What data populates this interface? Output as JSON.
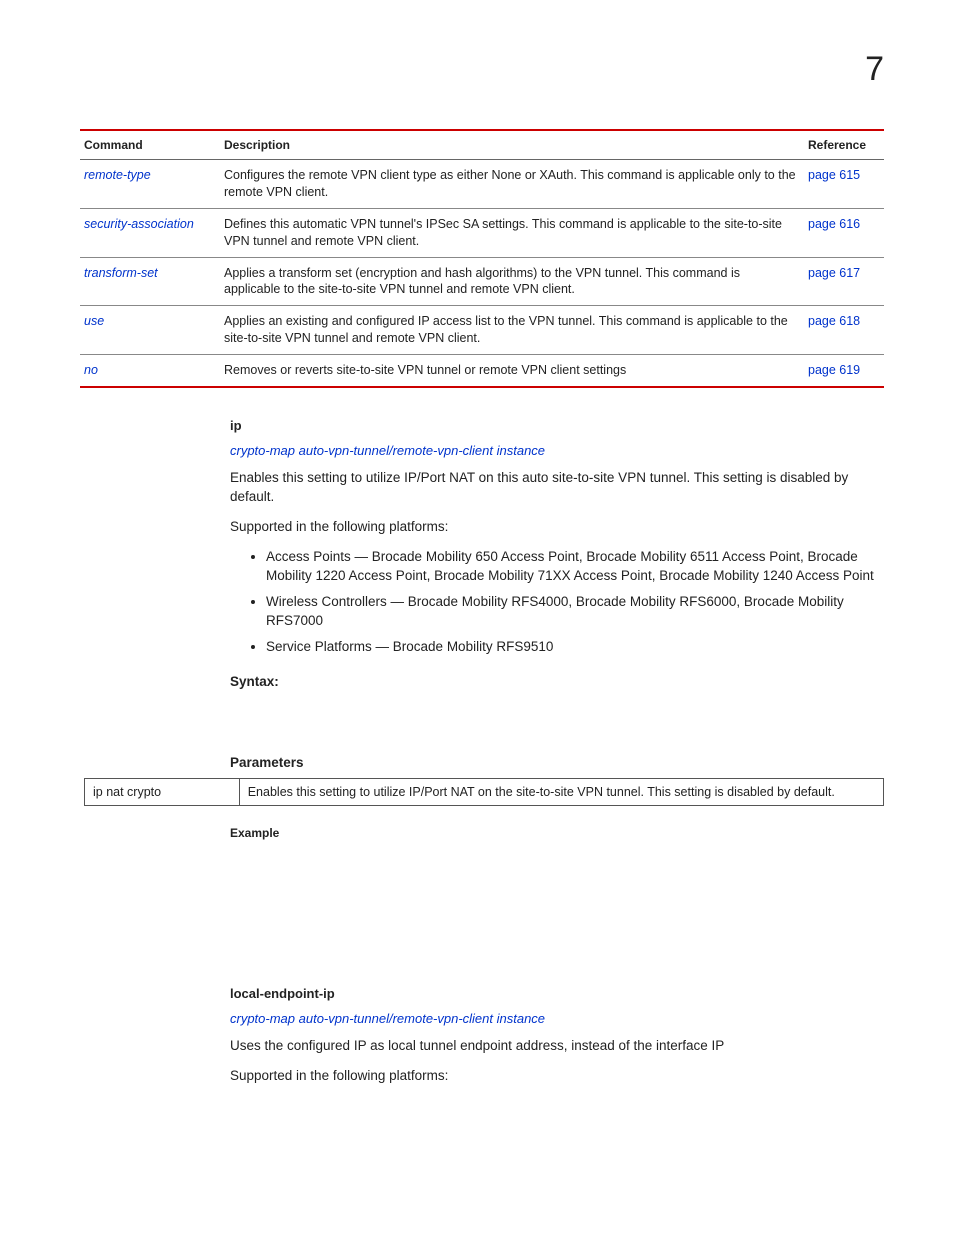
{
  "chapter_number": "7",
  "table": {
    "headers": {
      "cmd": "Command",
      "desc": "Description",
      "ref": "Reference"
    },
    "rows": [
      {
        "cmd": "remote-type",
        "desc": "Configures the remote VPN client type as either None or XAuth. This command is applicable only to the remote VPN client.",
        "ref": "page 615"
      },
      {
        "cmd": "security-association",
        "desc": "Defines this automatic VPN tunnel's IPSec SA settings. This command is applicable to the site-to-site VPN tunnel and remote VPN client.",
        "ref": "page 616"
      },
      {
        "cmd": "transform-set",
        "desc": "Applies a transform set (encryption and hash algorithms) to the VPN tunnel. This command is applicable to the site-to-site VPN tunnel and remote VPN client.",
        "ref": "page 617"
      },
      {
        "cmd": "use",
        "desc": "Applies an existing and configured IP access list to the VPN tunnel. This command is applicable to the site-to-site VPN tunnel and remote VPN client.",
        "ref": "page 618"
      },
      {
        "cmd": "no",
        "desc": "Removes or reverts site-to-site VPN tunnel or remote VPN client settings",
        "ref": "page 619"
      }
    ]
  },
  "ip_section": {
    "title": "ip",
    "crossref": "crypto-map auto-vpn-tunnel/remote-vpn-client instance",
    "intro": "Enables this setting to utilize IP/Port NAT on this auto site-to-site VPN tunnel. This setting is disabled by default.",
    "platforms_intro": "Supported in the following platforms:",
    "platforms": [
      "Access Points — Brocade Mobility 650 Access Point, Brocade Mobility 6511 Access Point, Brocade Mobility 1220 Access Point, Brocade Mobility 71XX Access Point, Brocade Mobility 1240 Access Point",
      "Wireless Controllers — Brocade Mobility RFS4000, Brocade Mobility RFS6000, Brocade Mobility RFS7000",
      "Service Platforms — Brocade Mobility RFS9510"
    ],
    "syntax_label": "Syntax:",
    "parameters_label": "Parameters",
    "param_table": {
      "key": "ip nat crypto",
      "desc": "Enables this setting to utilize IP/Port NAT on the site-to-site VPN tunnel. This setting is disabled by default."
    },
    "example_label": "Example"
  },
  "local_section": {
    "title": "local-endpoint-ip",
    "crossref": "crypto-map auto-vpn-tunnel/remote-vpn-client instance",
    "intro": "Uses the configured IP as local tunnel endpoint address, instead of the interface IP",
    "platforms_intro": "Supported in the following platforms:"
  }
}
